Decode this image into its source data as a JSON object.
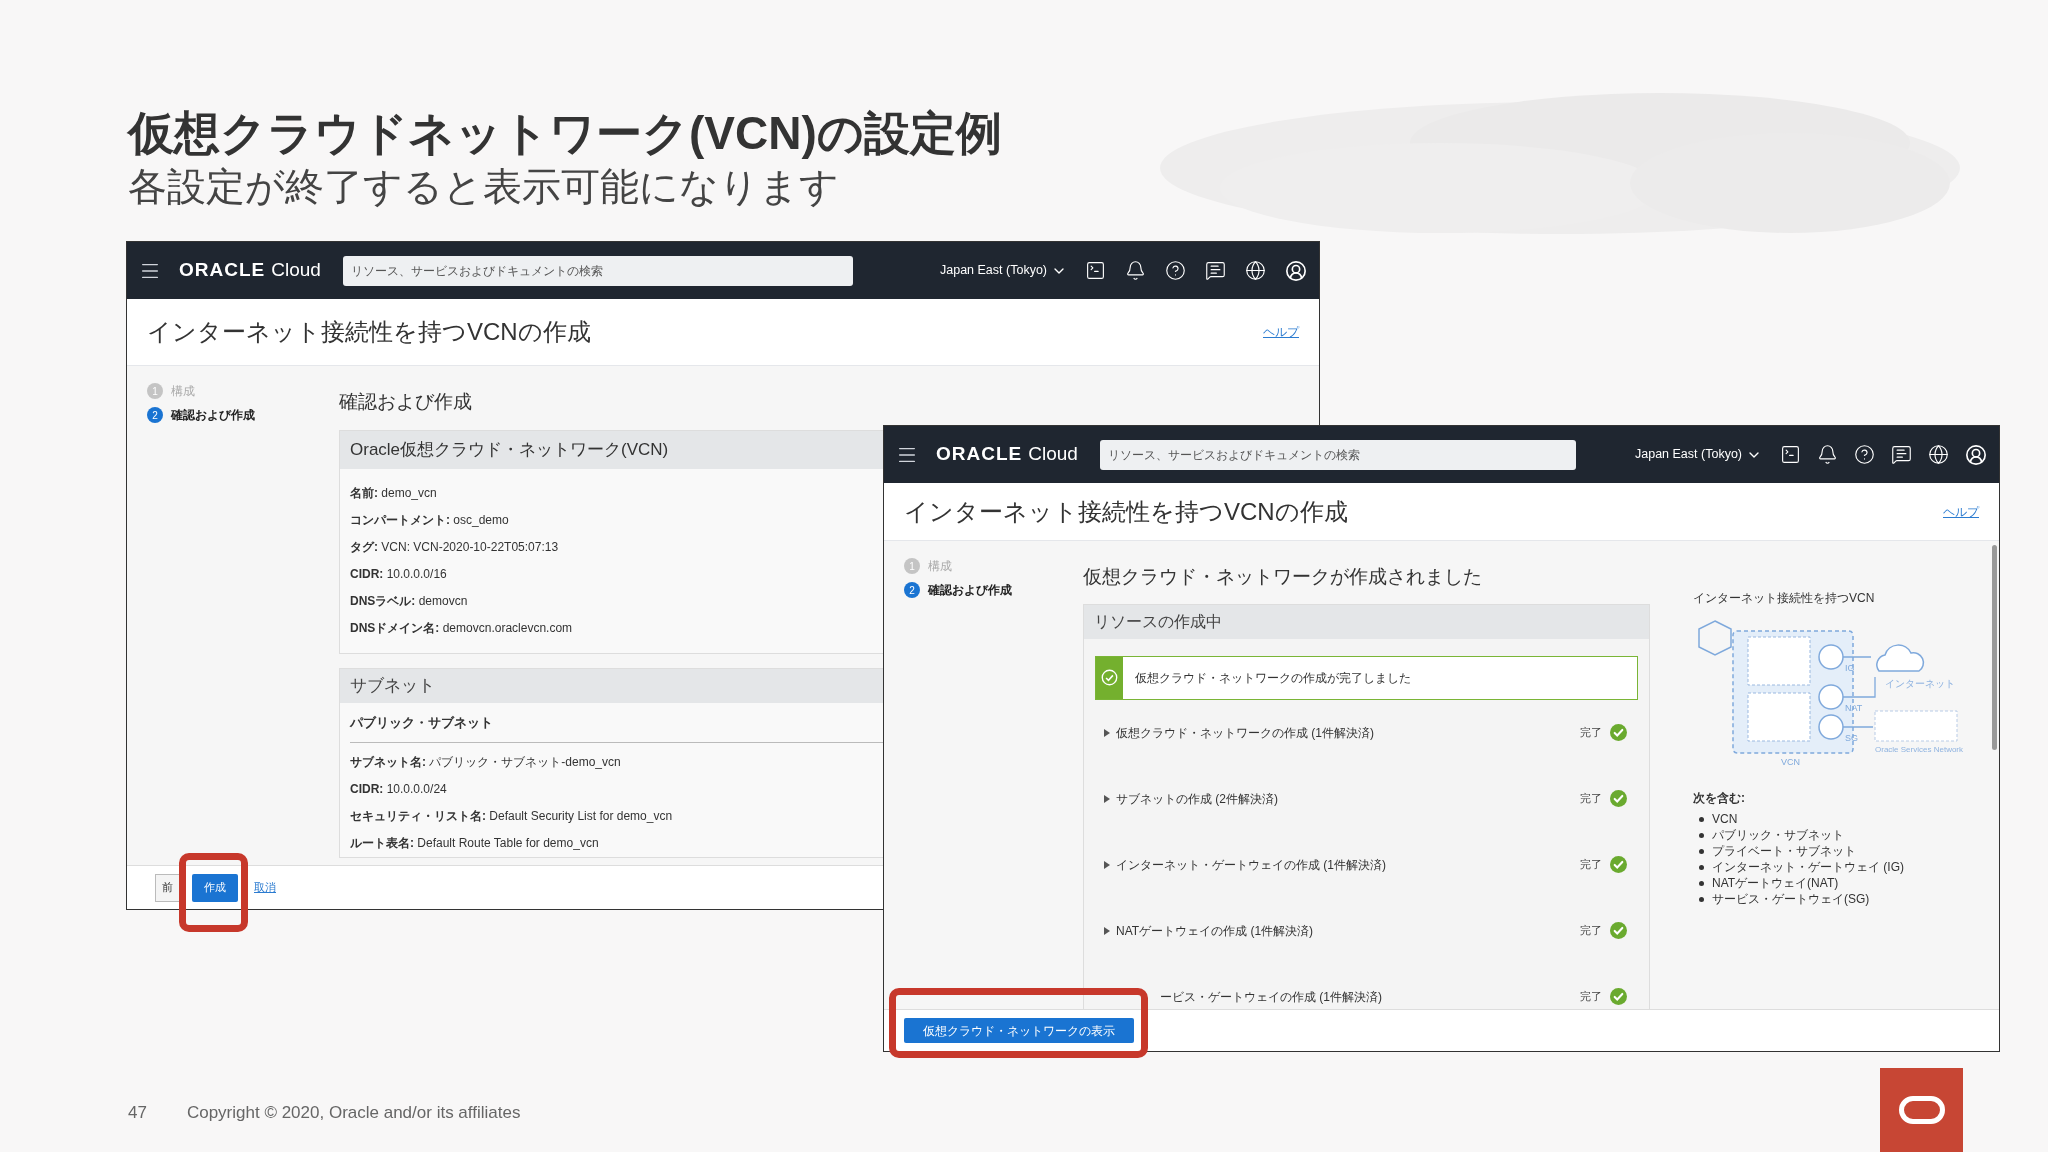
{
  "slide": {
    "title": "仮想クラウドネットワーク(VCN)の設定例",
    "subtitle": "各設定が終了すると表示可能になります",
    "page_number": "47",
    "copyright": "Copyright © 2020, Oracle and/or its affiliates"
  },
  "review_window": {
    "brand": {
      "logo": "ORACLE",
      "product": "Cloud"
    },
    "search": {
      "placeholder": "リソース、サービスおよびドキュメントの検索"
    },
    "region": "Japan East (Tokyo)",
    "page_title": "インターネット接続性を持つVCNの作成",
    "help_link": "ヘルプ",
    "steps": [
      {
        "number": "1",
        "label": "構成",
        "selected": false
      },
      {
        "number": "2",
        "label": "確認および作成",
        "selected": true
      }
    ],
    "heading": "確認および作成",
    "vcn_panel": {
      "title": "Oracle仮想クラウド・ネットワーク(VCN)",
      "fields": [
        {
          "label": "名前:",
          "value": "demo_vcn"
        },
        {
          "label": "コンパートメント:",
          "value": "osc_demo"
        },
        {
          "label": "タグ:",
          "value": "VCN: VCN-2020-10-22T05:07:13"
        },
        {
          "label": "CIDR:",
          "value": "10.0.0.0/16"
        },
        {
          "label": "DNSラベル:",
          "value": "demovcn"
        },
        {
          "label": "DNSドメイン名:",
          "value": "demovcn.oraclevcn.com"
        }
      ]
    },
    "subnet_panel": {
      "title": "サブネット",
      "subtitle": "パブリック・サブネット",
      "fields": [
        {
          "label": "サブネット名:",
          "value": "パブリック・サブネット-demo_vcn"
        },
        {
          "label": "CIDR:",
          "value": "10.0.0.0/24"
        },
        {
          "label": "セキュリティ・リスト名:",
          "value": "Default Security List for demo_vcn"
        },
        {
          "label": "ルート表名:",
          "value": "Default Route Table for demo_vcn"
        }
      ]
    },
    "footer": {
      "back_button": "前",
      "create_button": {
        "label": "作成",
        "highlighted": true
      },
      "cancel_link": "取消"
    }
  },
  "result_window": {
    "brand": {
      "logo": "ORACLE",
      "product": "Cloud"
    },
    "search": {
      "placeholder": "リソース、サービスおよびドキュメントの検索"
    },
    "region": "Japan East (Tokyo)",
    "page_title": "インターネット接続性を持つVCNの作成",
    "help_link": "ヘルプ",
    "steps": [
      {
        "number": "1",
        "label": "構成",
        "selected": false
      },
      {
        "number": "2",
        "label": "確認および作成",
        "selected": true
      }
    ],
    "heading": "仮想クラウド・ネットワークが作成されました",
    "progress_panel": {
      "title": "リソースの作成中",
      "success_message": "仮想クラウド・ネットワークの作成が完了しました",
      "rows": [
        {
          "kind": "row",
          "label": "仮想クラウド・ネットワークの作成 (1件解決済)",
          "status": "完了",
          "done": true
        },
        {
          "kind": "row",
          "label": "サブネットの作成 (2件解決済)",
          "status": "完了",
          "done": true
        },
        {
          "kind": "row",
          "label": "インターネット・ゲートウェイの作成 (1件解決済)",
          "status": "完了",
          "done": true
        },
        {
          "kind": "row",
          "label": "NATゲートウェイの作成 (1件解決済)",
          "status": "完了",
          "done": true
        },
        {
          "kind": "cut",
          "label": "ービス・ゲートウェイの作成 (1件解決済)",
          "status": "完了",
          "done": true
        }
      ]
    },
    "info": {
      "title": "インターネット接続性を持つVCN",
      "diagram_labels": {
        "gateway_1": "IG",
        "gateway_2": "NAT",
        "gateway_3": "SG",
        "network": "VCN",
        "internet": "インターネット",
        "services": "Oracle Services Network"
      },
      "includes_title": "次を含む:",
      "includes": [
        "VCN",
        "パブリック・サブネット",
        "プライベート・サブネット",
        "インターネット・ゲートウェイ (IG)",
        "NATゲートウェイ(NAT)",
        "サービス・ゲートウェイ(SG)"
      ]
    },
    "footer": {
      "view_button": {
        "label": "仮想クラウド・ネットワークの表示",
        "highlighted": true
      }
    }
  }
}
